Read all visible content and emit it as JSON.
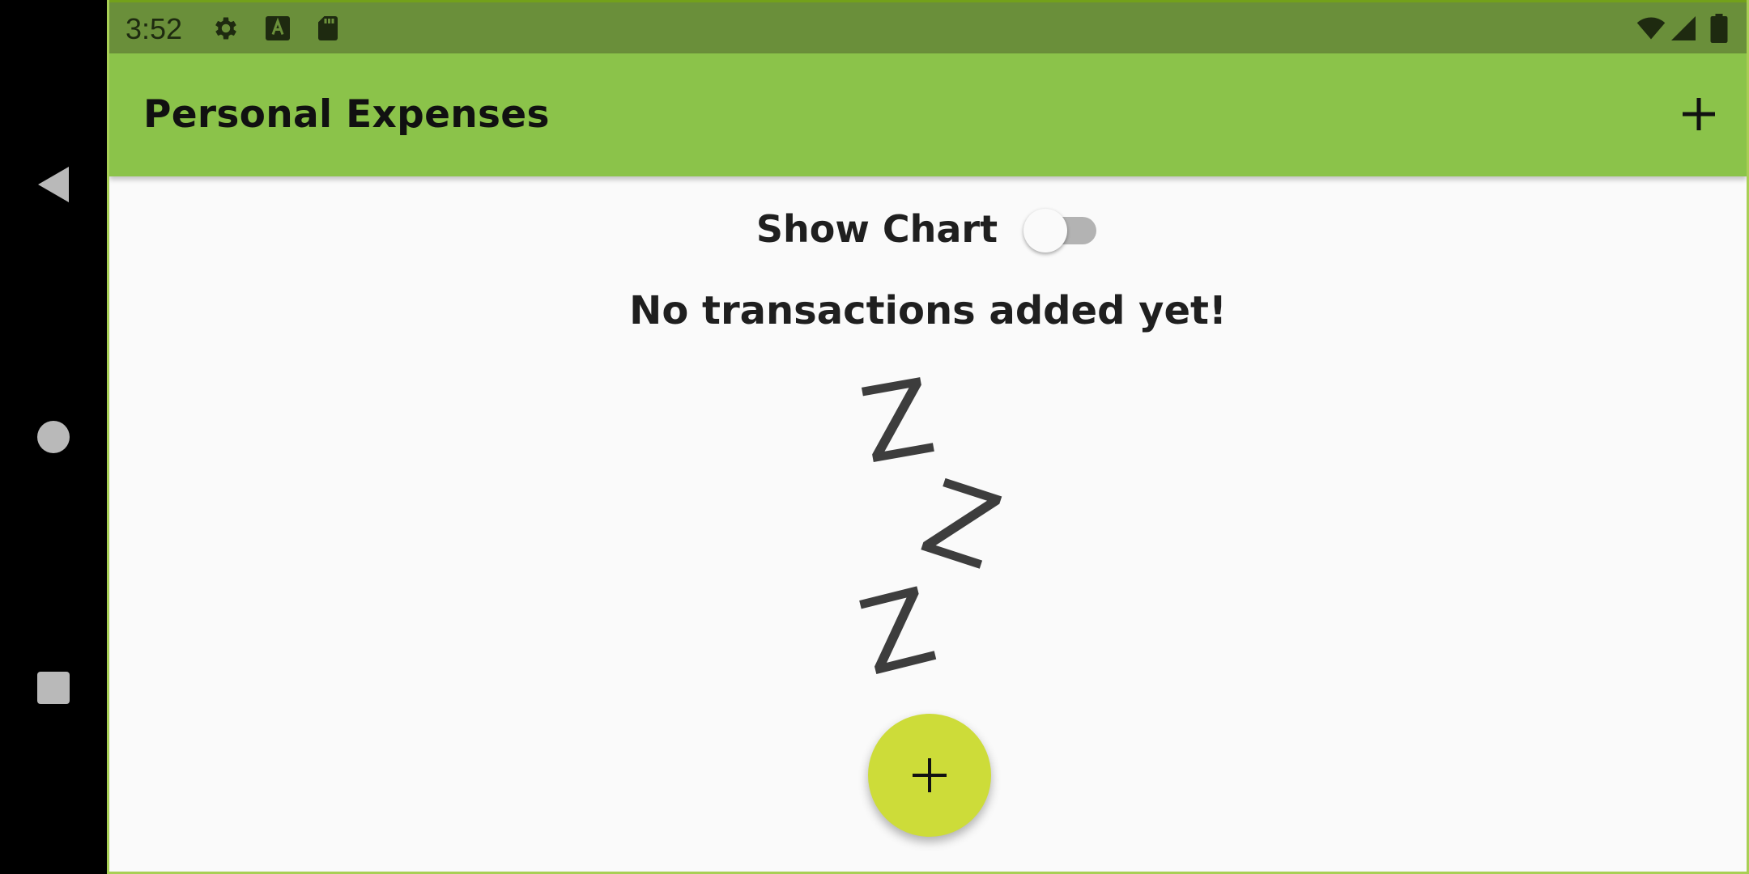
{
  "status_bar": {
    "time": "3:52",
    "icons": [
      "gear-icon",
      "keyboard-a-icon",
      "sd-card-icon",
      "wifi-icon",
      "cell-signal-icon",
      "battery-icon"
    ]
  },
  "nav_bar": {
    "buttons": [
      "back-icon",
      "home-icon",
      "recents-icon"
    ]
  },
  "app_bar": {
    "title": "Personal Expenses",
    "action_icon": "plus-icon",
    "color": "#8bc34a"
  },
  "main": {
    "toggle_label": "Show Chart",
    "toggle_on": false,
    "empty_message": "No transactions added yet!",
    "empty_image": "zzz-sleep-icon",
    "zzz_letters": [
      "Z",
      "Z",
      "Z"
    ]
  },
  "fab": {
    "icon": "plus-icon",
    "color": "#cddc39"
  }
}
